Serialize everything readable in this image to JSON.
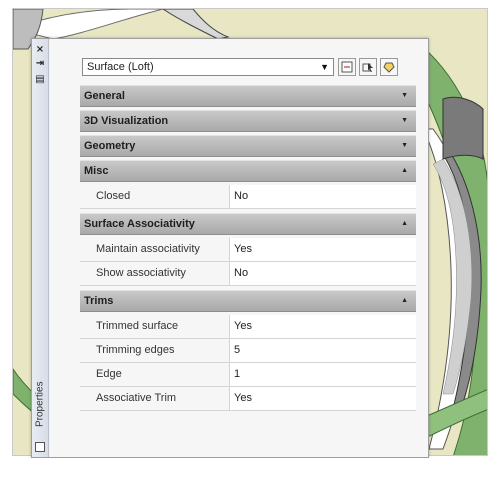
{
  "palette": {
    "title": "Properties",
    "selector": {
      "value": "Surface (Loft)",
      "icons": [
        "toggle-pickadd-icon",
        "select-objects-icon",
        "quick-select-icon"
      ]
    },
    "categories": [
      {
        "label": "General",
        "expanded": false,
        "properties": []
      },
      {
        "label": "3D Visualization",
        "expanded": false,
        "properties": []
      },
      {
        "label": "Geometry",
        "expanded": false,
        "properties": []
      },
      {
        "label": "Misc",
        "expanded": true,
        "properties": [
          {
            "name": "Closed",
            "value": "No"
          }
        ]
      },
      {
        "label": "Surface Associativity",
        "expanded": true,
        "properties": [
          {
            "name": "Maintain associativity",
            "value": "Yes"
          },
          {
            "name": "Show associativity",
            "value": "No"
          }
        ]
      },
      {
        "label": "Trims",
        "expanded": true,
        "properties": [
          {
            "name": "Trimmed surface",
            "value": "Yes"
          },
          {
            "name": "Trimming edges",
            "value": "5"
          },
          {
            "name": "Edge",
            "value": "1"
          },
          {
            "name": "Associative Trim",
            "value": "Yes"
          }
        ]
      }
    ]
  },
  "colors": {
    "viewport_bg": "#e9e6c4",
    "surface_green": "#7fb26d",
    "category_header": "#b3b3b3"
  }
}
